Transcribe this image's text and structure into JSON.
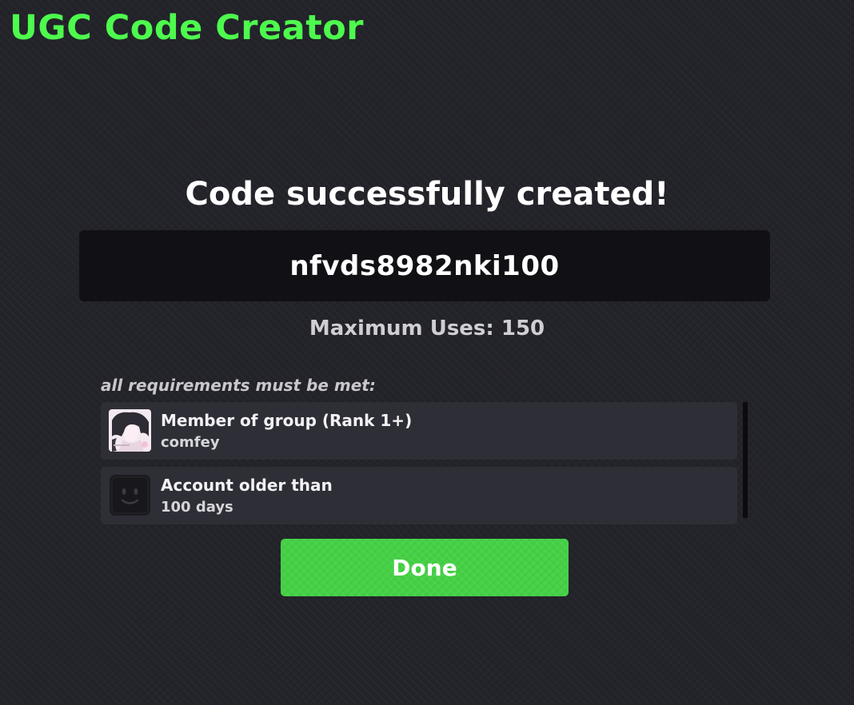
{
  "app": {
    "title": "UGC Code Creator",
    "title_color": "#4dfa4d"
  },
  "result": {
    "heading": "Code successfully created!",
    "code": "nfvds8982nki100",
    "max_uses": "Maximum Uses: 150"
  },
  "requirements": {
    "heading": "all requirements must be met:",
    "items": [
      {
        "title": "Member of group (Rank 1+)",
        "subtitle": "comfey",
        "icon": "group-avatar-icon"
      },
      {
        "title": "Account older than",
        "subtitle": "100 days",
        "icon": "account-avatar-icon"
      }
    ]
  },
  "actions": {
    "done_label": "Done",
    "done_color": "#45d145"
  }
}
